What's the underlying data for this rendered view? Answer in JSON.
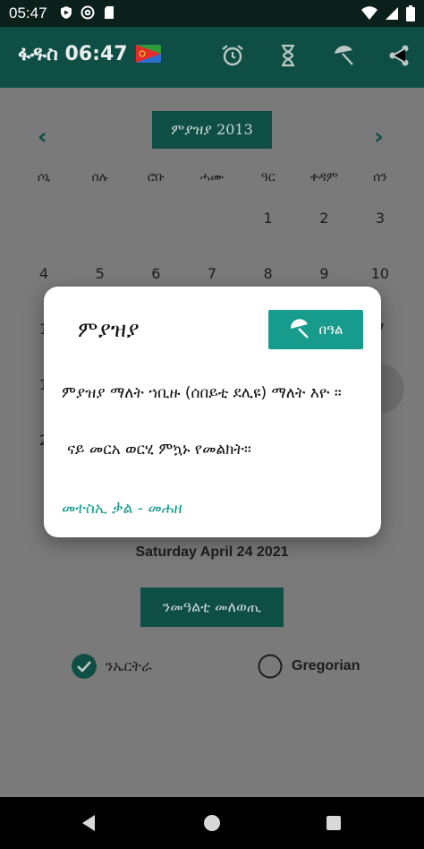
{
  "status_bar": {
    "time": "05:47"
  },
  "app_bar": {
    "title": "ፋዱስ 06:47",
    "icons": [
      "alarm-icon",
      "hourglass-icon",
      "umbrella-icon",
      "share-icon"
    ]
  },
  "calendar": {
    "prev": "‹",
    "next": "›",
    "month_label": "ምያዝያ 2013",
    "weekdays": [
      "ሶኒ",
      "ሰሉ",
      "ሮቡ",
      "ሓሙ",
      "ዓር",
      "ቀዳም",
      "ሰን"
    ],
    "rows": [
      [
        "",
        "",
        "",
        "",
        "1",
        "2",
        "3"
      ],
      [
        "4",
        "5",
        "6",
        "7",
        "8",
        "9",
        "10"
      ],
      [
        "1",
        "",
        "",
        "",
        "",
        "",
        "7"
      ],
      [
        "1",
        "",
        "",
        "",
        "",
        "",
        ""
      ],
      [
        "2",
        "",
        "",
        "",
        "",
        "",
        ""
      ]
    ]
  },
  "selected_date": "Saturday April 24 2021",
  "convert_button": "ንመዓልቲ መለወጢ",
  "radios": {
    "eritrean": {
      "label": "ንኤርትራ",
      "checked": true
    },
    "gregorian": {
      "label": "Gregorian",
      "checked": false
    }
  },
  "dialog": {
    "title": "ምያዝያ",
    "button_label": "በዓል",
    "text1": "ምያዝያ ማለት ኀቢዙ (ሰበይቲ ደሊዩ) ማለት እዮ ።",
    "text2": "ናይ መርአ ወርሂ ምኳኑ የመልክት።",
    "link": "መተስኢ ቃል - መሐዘ"
  },
  "colors": {
    "primary": "#0f4e45",
    "accent": "#179b8c",
    "scrim": "#7a7a7a"
  }
}
